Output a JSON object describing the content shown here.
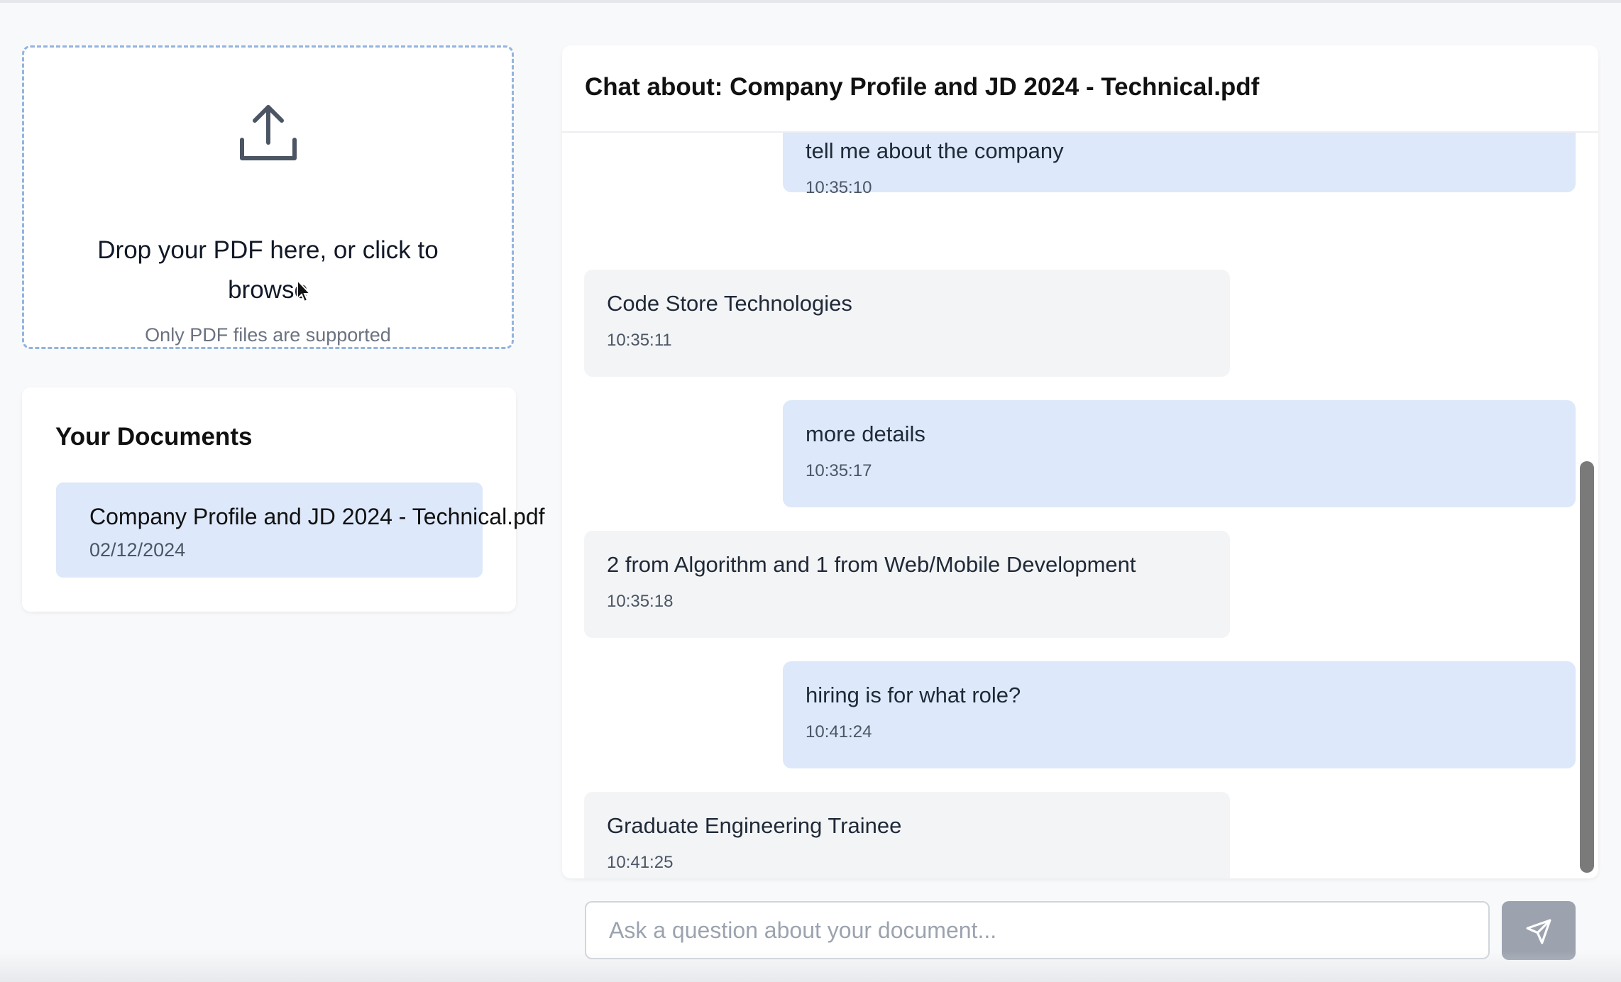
{
  "upload": {
    "icon": "upload-icon",
    "title": "Drop your PDF here, or click to browse",
    "subtitle": "Only PDF files are supported"
  },
  "documents": {
    "title": "Your Documents",
    "items": [
      {
        "name": "Company Profile and JD 2024 - Technical.pdf",
        "date": "02/12/2024"
      }
    ]
  },
  "chat": {
    "title": "Chat about: Company Profile and JD 2024 - Technical.pdf",
    "messages": [
      {
        "role": "user",
        "text": "tell me about the company",
        "time": "10:35:10"
      },
      {
        "role": "assistant",
        "text": "Code Store Technologies",
        "time": "10:35:11"
      },
      {
        "role": "user",
        "text": "more details",
        "time": "10:35:17"
      },
      {
        "role": "assistant",
        "text": "2 from Algorithm and 1 from Web/Mobile Development",
        "time": "10:35:18"
      },
      {
        "role": "user",
        "text": "hiring is for what role?",
        "time": "10:41:24"
      },
      {
        "role": "assistant",
        "text": "Graduate Engineering Trainee",
        "time": "10:41:25"
      }
    ],
    "input": {
      "placeholder": "Ask a question about your document...",
      "value": ""
    },
    "send_icon": "send-icon"
  },
  "colors": {
    "user_bubble": "#dde8fa",
    "assistant_bubble": "#f3f4f6",
    "dashed_border": "#93b4dc",
    "send_button": "#9ca3af"
  }
}
